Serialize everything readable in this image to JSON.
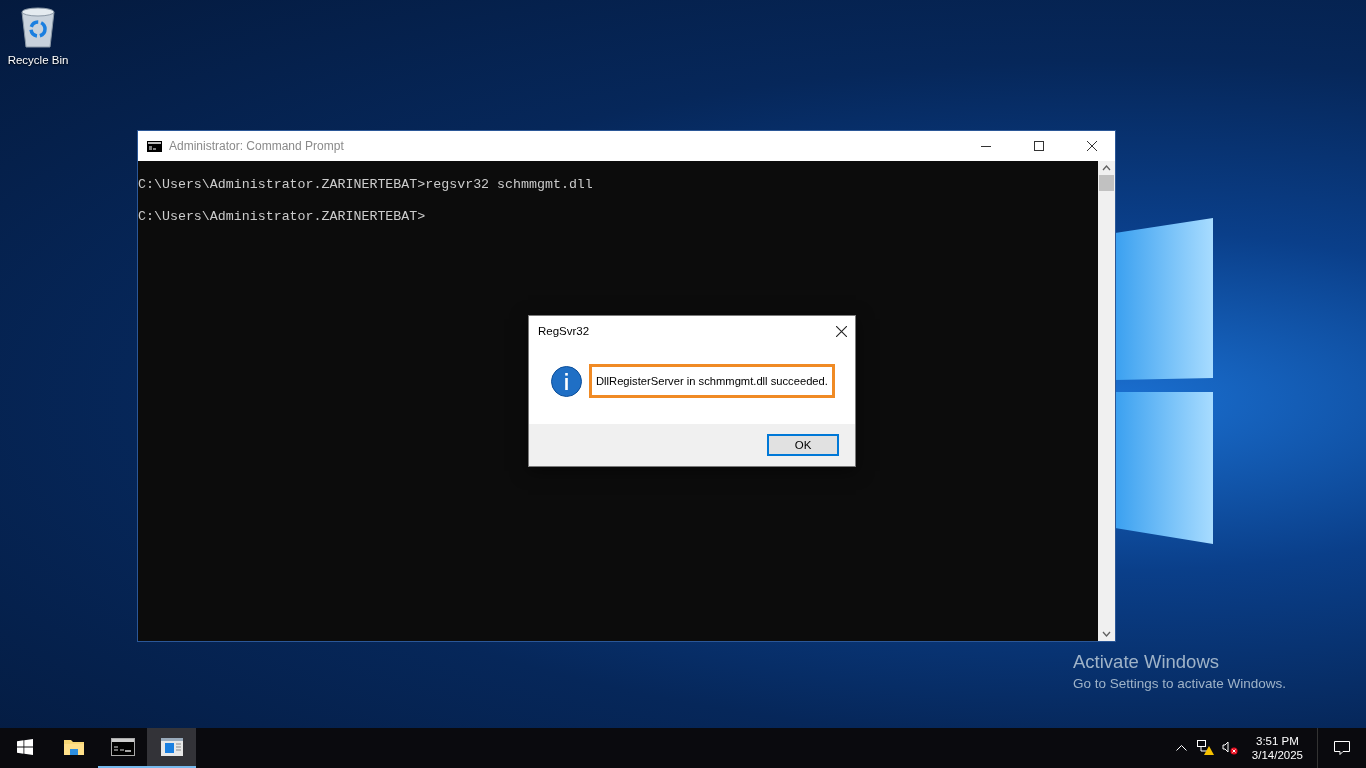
{
  "desktop": {
    "icons": [
      {
        "label": "Recycle Bin"
      }
    ]
  },
  "console": {
    "title": "Administrator: Command Prompt",
    "lines": [
      "C:\\Users\\Administrator.ZARINERTEBAT>regsvr32 schmmgmt.dll",
      "C:\\Users\\Administrator.ZARINERTEBAT>"
    ]
  },
  "dialog": {
    "title": "RegSvr32",
    "message": "DllRegisterServer in schmmgmt.dll succeeded.",
    "highlighted": true,
    "button": "OK"
  },
  "activation_notice": {
    "title": "Activate Windows",
    "subtitle": "Go to Settings to activate Windows."
  },
  "taskbar": {
    "apps": [
      {
        "kind": "explorer",
        "running": false,
        "selected": false
      },
      {
        "kind": "console",
        "running": true,
        "selected": false
      },
      {
        "kind": "dialog",
        "running": true,
        "selected": true
      }
    ],
    "time": "3:51 PM",
    "date": "3/14/2025"
  }
}
